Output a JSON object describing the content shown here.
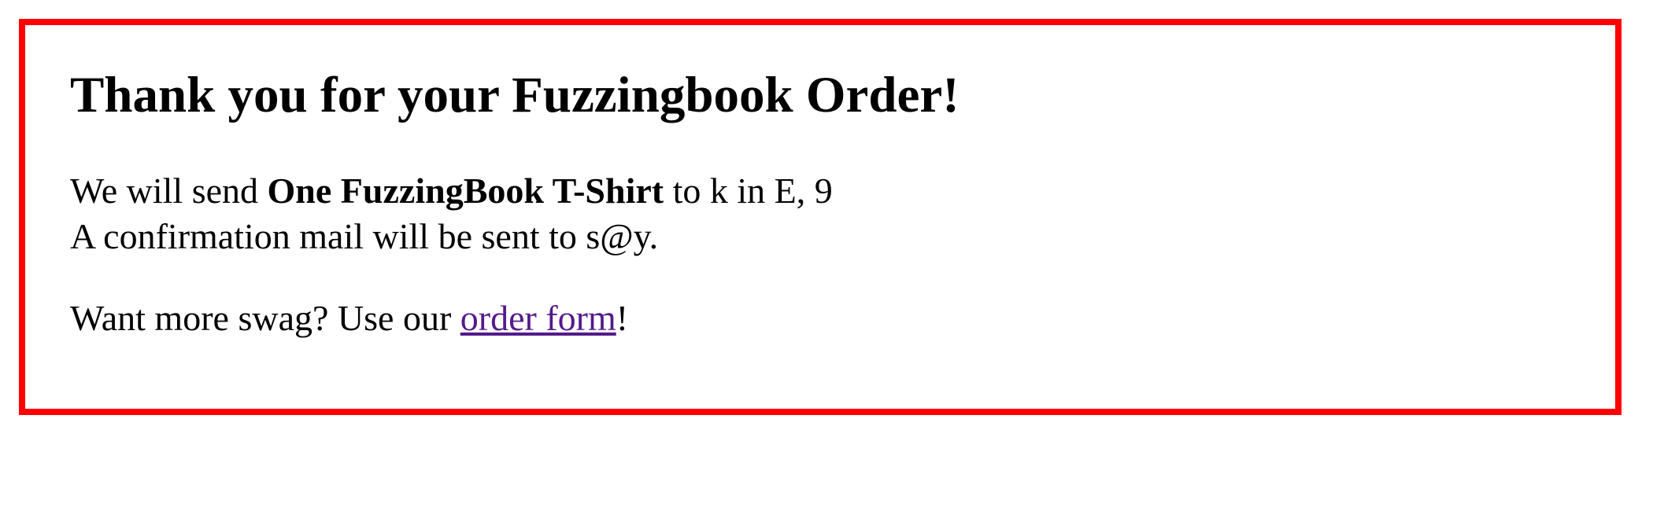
{
  "title": "Thank you for your Fuzzingbook Order!",
  "order": {
    "prefix": "We will send",
    "product": "One FuzzingBook T-Shirt",
    "to_text": "to",
    "name": "k",
    "in_text": "in",
    "city": "E",
    "zip": "9"
  },
  "confirmation": {
    "prefix": "A confirmation mail will be sent to",
    "email": "s@y",
    "suffix": "."
  },
  "swag": {
    "prefix": "Want more swag? Use our",
    "link_text": "order form",
    "suffix": "!"
  },
  "colors": {
    "border": "#ff0000",
    "visited_link": "#551a8b"
  }
}
